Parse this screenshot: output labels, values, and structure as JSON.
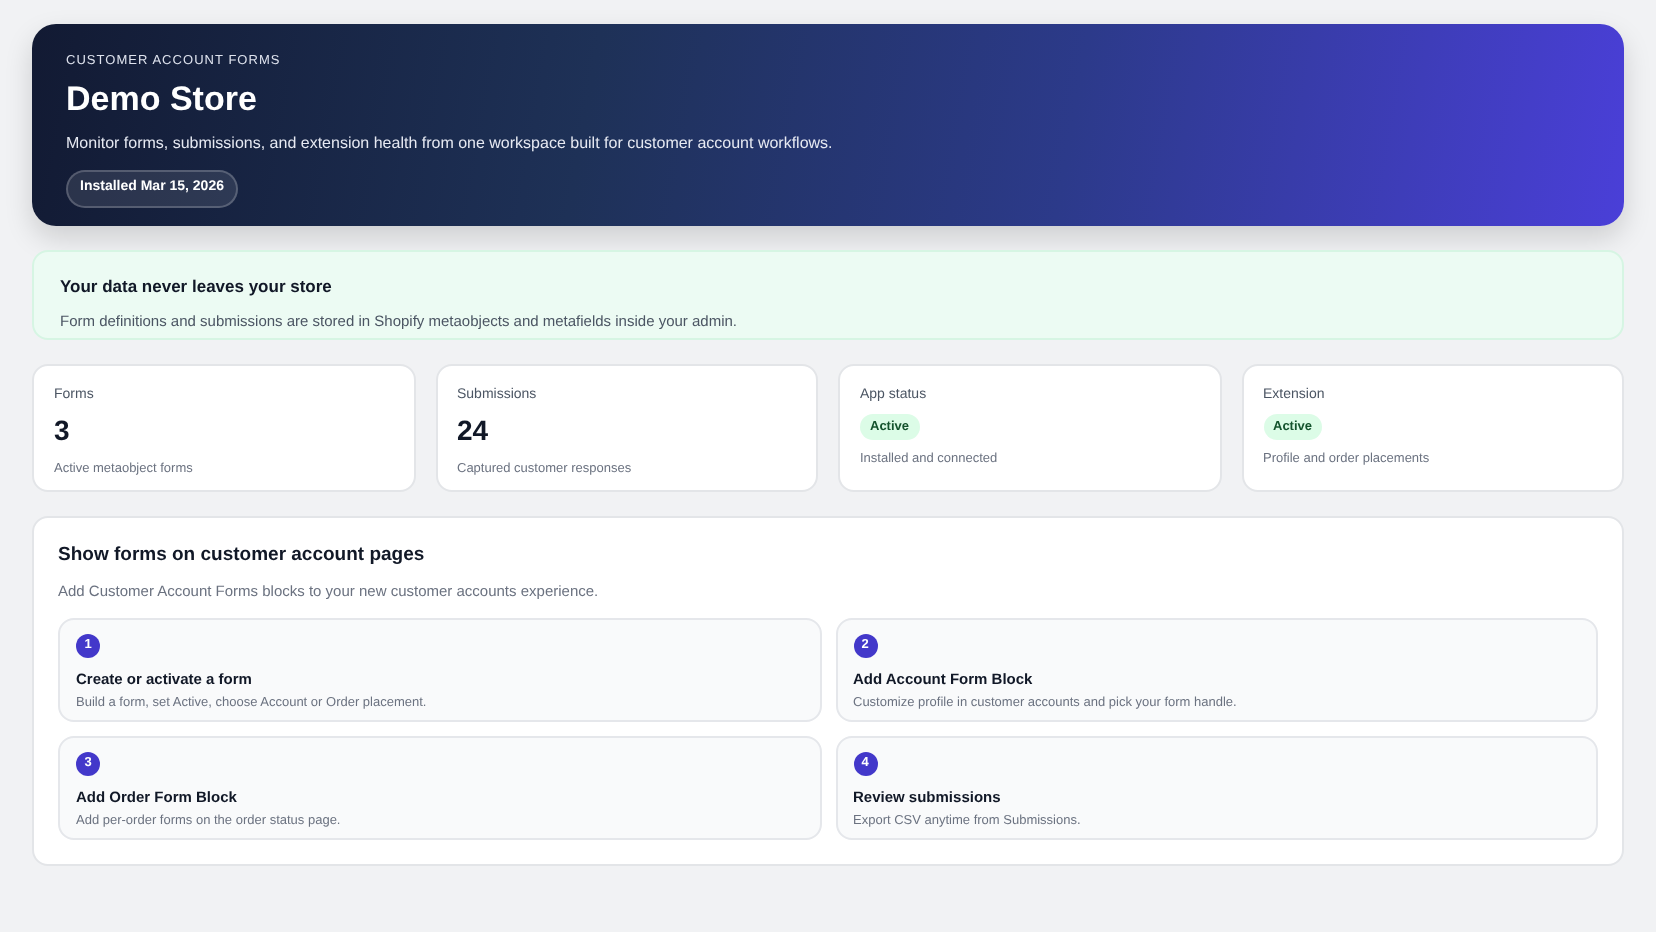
{
  "hero": {
    "eyebrow": "CUSTOMER ACCOUNT FORMS",
    "title": "Demo Store",
    "subtitle": "Monitor forms, submissions, and extension health from one workspace built for customer account workflows.",
    "badge": "Installed Mar 15, 2026"
  },
  "notice": {
    "title": "Your data never leaves your store",
    "text": "Form definitions and submissions are stored in Shopify metaobjects and metafields inside your admin."
  },
  "stats": [
    {
      "kind": "number",
      "label": "Forms",
      "value": "3",
      "caption": "Active metaobject forms"
    },
    {
      "kind": "number",
      "label": "Submissions",
      "value": "24",
      "caption": "Captured customer responses"
    },
    {
      "kind": "badge",
      "label": "App status",
      "value": "Active",
      "caption": "Installed and connected"
    },
    {
      "kind": "badge",
      "label": "Extension",
      "value": "Active",
      "caption": "Profile and order placements"
    }
  ],
  "setup": {
    "title": "Show forms on customer account pages",
    "subtitle": "Add Customer Account Forms blocks to your new customer accounts experience.",
    "steps": [
      {
        "number": "1",
        "title": "Create or activate a form",
        "text": "Build a form, set Active, choose Account or Order placement."
      },
      {
        "number": "2",
        "title": "Add Account Form Block",
        "text": "Customize profile in customer accounts and pick your form handle."
      },
      {
        "number": "3",
        "title": "Add Order Form Block",
        "text": "Add per-order forms on the order status page."
      },
      {
        "number": "4",
        "title": "Review submissions",
        "text": "Export CSV anytime from Submissions."
      }
    ]
  }
}
